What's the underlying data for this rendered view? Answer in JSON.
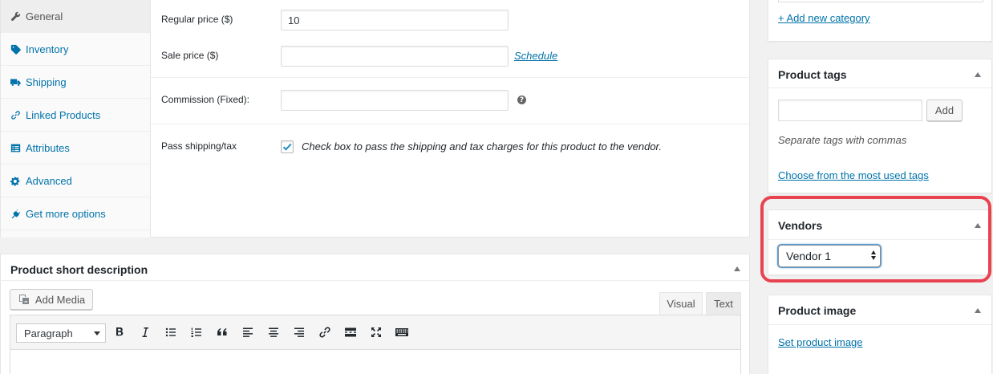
{
  "product_data": {
    "tabs": [
      {
        "label": "General",
        "icon": "wrench-icon",
        "active": true
      },
      {
        "label": "Inventory",
        "icon": "tag-icon",
        "active": false
      },
      {
        "label": "Shipping",
        "icon": "truck-icon",
        "active": false
      },
      {
        "label": "Linked Products",
        "icon": "link-icon",
        "active": false
      },
      {
        "label": "Attributes",
        "icon": "list-icon",
        "active": false
      },
      {
        "label": "Advanced",
        "icon": "gear-icon",
        "active": false
      },
      {
        "label": "Get more options",
        "icon": "plug-icon",
        "active": false
      }
    ],
    "regular_price": {
      "label": "Regular price ($)",
      "value": "10"
    },
    "sale_price": {
      "label": "Sale price ($)",
      "value": "",
      "schedule_link": "Schedule"
    },
    "commission": {
      "label": "Commission (Fixed):",
      "value": "",
      "help": "?"
    },
    "pass_shipping": {
      "label": "Pass shipping/tax",
      "checked": true,
      "description": "Check box to pass the shipping and tax charges for this product to the vendor."
    }
  },
  "short_description": {
    "title": "Product short description",
    "add_media_label": "Add Media",
    "tab_visual": "Visual",
    "tab_text": "Text",
    "format_value": "Paragraph"
  },
  "categories": {
    "add_new_link": "+ Add new category"
  },
  "product_tags": {
    "title": "Product tags",
    "input_value": "",
    "add_button": "Add",
    "hint": "Separate tags with commas",
    "choose_link": "Choose from the most used tags"
  },
  "vendors": {
    "title": "Vendors",
    "selected": "Vendor 1"
  },
  "product_image": {
    "title": "Product image",
    "set_link": "Set product image"
  },
  "colors": {
    "link": "#0073aa",
    "highlight": "#e8434f"
  }
}
